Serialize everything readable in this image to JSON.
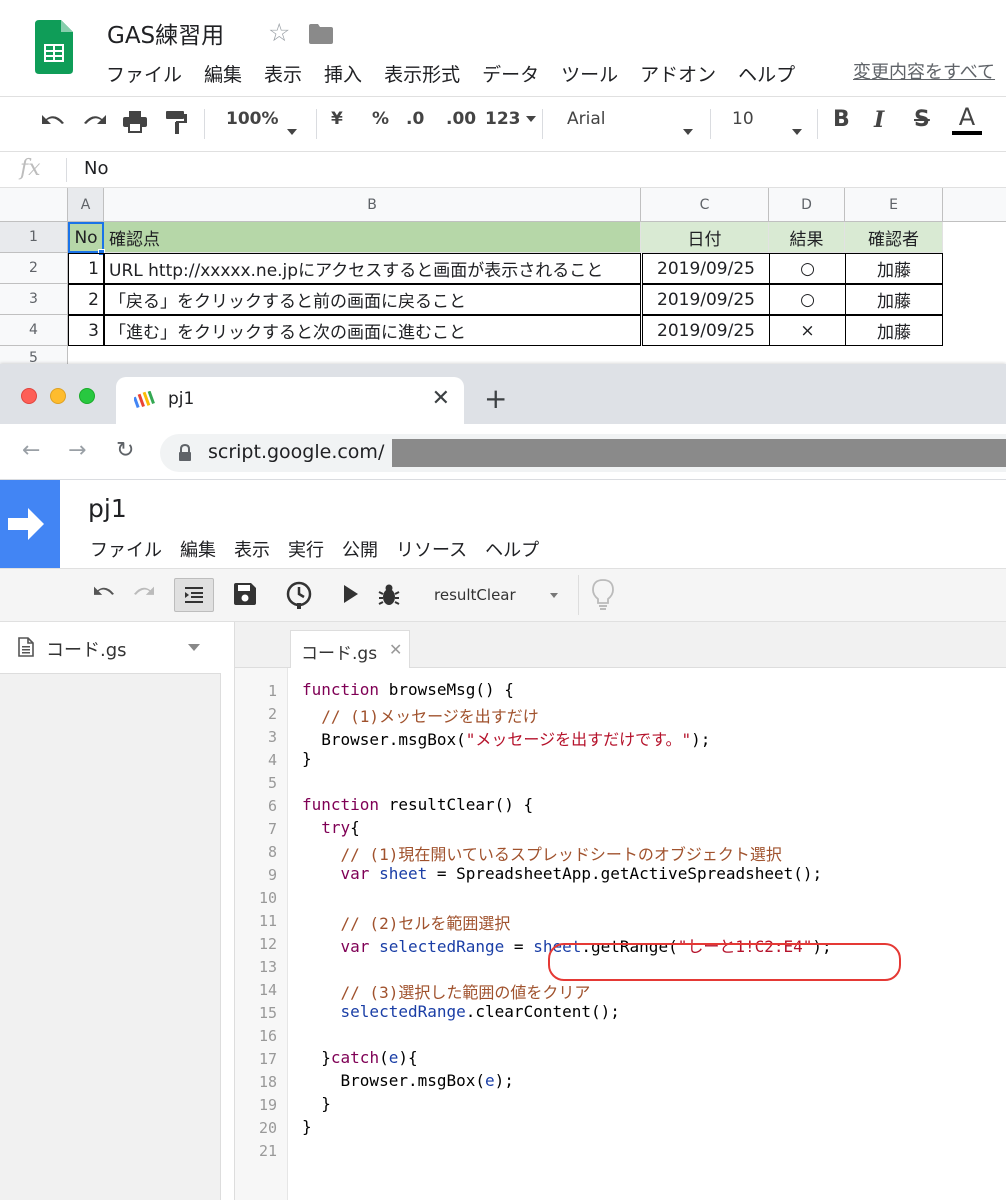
{
  "sheets": {
    "title": "GAS練習用",
    "menu": [
      "ファイル",
      "編集",
      "表示",
      "挿入",
      "表示形式",
      "データ",
      "ツール",
      "アドオン",
      "ヘルプ"
    ],
    "changes_link": "変更内容をすべて",
    "toolbar": {
      "zoom": "100%",
      "currency": "¥",
      "percent": "%",
      "dec_less": ".0",
      "dec_more": ".00",
      "format_more": "123",
      "font": "Arial",
      "font_size": "10",
      "bold": "B",
      "italic": "I",
      "strike": "S",
      "text_color": "A"
    },
    "fx_label": "fx",
    "formula_value": "No",
    "columns": [
      "A",
      "B",
      "C",
      "D",
      "E"
    ],
    "rows": [
      "1",
      "2",
      "3",
      "4",
      "5"
    ],
    "header_row": [
      "No",
      "確認点",
      "日付",
      "結果",
      "確認者"
    ],
    "data_rows": [
      [
        "1",
        "URL http://xxxxx.ne.jpにアクセスすると画面が表示されること",
        "2019/09/25",
        "○",
        "加藤"
      ],
      [
        "2",
        "「戻る」をクリックすると前の画面に戻ること",
        "2019/09/25",
        "○",
        "加藤"
      ],
      [
        "3",
        "「進む」をクリックすると次の画面に進むこと",
        "2019/09/25",
        "×",
        "加藤"
      ]
    ]
  },
  "browser": {
    "tab_title": "pj1",
    "url": "script.google.com/"
  },
  "apps_script": {
    "project_title": "pj1",
    "menu": [
      "ファイル",
      "編集",
      "表示",
      "実行",
      "公開",
      "リソース",
      "ヘルプ"
    ],
    "selected_function": "resultClear",
    "file_name": "コード.gs",
    "editor_tab": "コード.gs",
    "line_numbers": [
      "1",
      "2",
      "3",
      "4",
      "5",
      "6",
      "7",
      "8",
      "9",
      "10",
      "11",
      "12",
      "13",
      "14",
      "15",
      "16",
      "17",
      "18",
      "19",
      "20",
      "21"
    ],
    "code": {
      "l1_kw": "function",
      "l1_rest": " browseMsg() {",
      "l2": "  // (1)メッセージを出すだけ",
      "l3_pre": "  Browser.msgBox(",
      "l3_str": "\"メッセージを出すだけです。\"",
      "l3_post": ");",
      "l4": "}",
      "l6_kw": "function",
      "l6_rest": " resultClear() {",
      "l7_pre": "  ",
      "l7_kw": "try",
      "l7_post": "{",
      "l8": "    // (1)現在開いているスプレッドシートのオブジェクト選択",
      "l9_kw": "    var",
      "l9_var": " sheet",
      "l9_rest": " = SpreadsheetApp.getActiveSpreadsheet();",
      "l11": "    // (2)セルを範囲選択",
      "l12_kw": "    var",
      "l12_var": " selectedRange",
      "l12_eq": " = ",
      "l12_var2": "sheet",
      "l12_mid": ".getRange(",
      "l12_str": "\"しーと1!C2:E4\"",
      "l12_post": ");",
      "l14": "    // (3)選択した範囲の値をクリア",
      "l15_var": "    selectedRange",
      "l15_rest": ".clearContent();",
      "l17_pre": "  }",
      "l17_kw": "catch",
      "l17_mid": "(",
      "l17_var": "e",
      "l17_post": "){",
      "l18_pre": "    Browser.msgBox(",
      "l18_var": "e",
      "l18_post": ");",
      "l19": "  }",
      "l20": "}"
    }
  },
  "colors": {
    "sheets_green": "#0f9d58",
    "header_green": "#b6d7a8",
    "header_light_green": "#d9ead3",
    "apps_script_blue": "#4285f4",
    "highlight_red": "#e53935"
  }
}
